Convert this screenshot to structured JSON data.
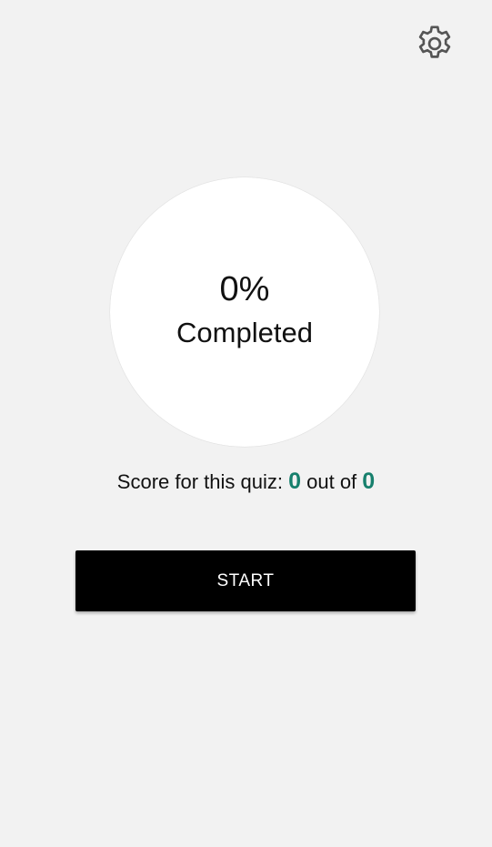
{
  "colors": {
    "background": "#f2f2f2",
    "circle_fill": "#ffffff",
    "accent": "#17806d",
    "button_bg": "#000000",
    "button_text": "#ffffff",
    "icon": "#555555"
  },
  "header": {
    "settings_icon": "gear-icon"
  },
  "progress": {
    "percent_text": "0%",
    "label": "Completed"
  },
  "score": {
    "prefix": "Score for this quiz: ",
    "value": "0",
    "middle": " out of ",
    "total": "0"
  },
  "actions": {
    "start_label": "START"
  }
}
